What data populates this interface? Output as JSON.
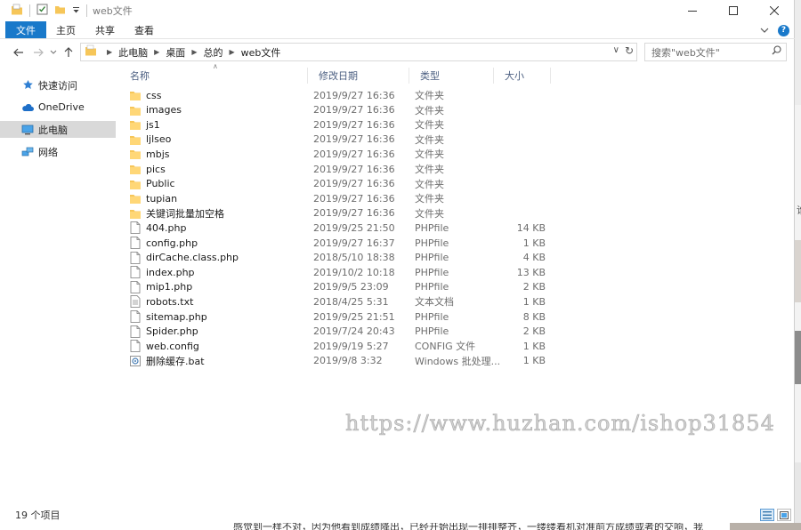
{
  "window": {
    "title": "web文件"
  },
  "ribbon": {
    "tabs": [
      "文件",
      "主页",
      "共享",
      "查看"
    ]
  },
  "address": {
    "crumbs": [
      "此电脑",
      "桌面",
      "总的",
      "web文件"
    ]
  },
  "search": {
    "placeholder": "搜索\"web文件\""
  },
  "sidebar": {
    "items": [
      {
        "label": "快速访问"
      },
      {
        "label": "OneDrive"
      },
      {
        "label": "此电脑"
      },
      {
        "label": "网络"
      }
    ]
  },
  "columns": {
    "name": "名称",
    "date": "修改日期",
    "type": "类型",
    "size": "大小"
  },
  "files": [
    {
      "name": "css",
      "date": "2019/9/27 16:36",
      "type": "文件夹",
      "size": "",
      "kind": "folder"
    },
    {
      "name": "images",
      "date": "2019/9/27 16:36",
      "type": "文件夹",
      "size": "",
      "kind": "folder"
    },
    {
      "name": "js1",
      "date": "2019/9/27 16:36",
      "type": "文件夹",
      "size": "",
      "kind": "folder"
    },
    {
      "name": "ljlseo",
      "date": "2019/9/27 16:36",
      "type": "文件夹",
      "size": "",
      "kind": "folder"
    },
    {
      "name": "mbjs",
      "date": "2019/9/27 16:36",
      "type": "文件夹",
      "size": "",
      "kind": "folder"
    },
    {
      "name": "pics",
      "date": "2019/9/27 16:36",
      "type": "文件夹",
      "size": "",
      "kind": "folder"
    },
    {
      "name": "Public",
      "date": "2019/9/27 16:36",
      "type": "文件夹",
      "size": "",
      "kind": "folder"
    },
    {
      "name": "tupian",
      "date": "2019/9/27 16:36",
      "type": "文件夹",
      "size": "",
      "kind": "folder"
    },
    {
      "name": "关键词批量加空格",
      "date": "2019/9/27 16:36",
      "type": "文件夹",
      "size": "",
      "kind": "folder"
    },
    {
      "name": "404.php",
      "date": "2019/9/25 21:50",
      "type": "PHPfile",
      "size": "14 KB",
      "kind": "file"
    },
    {
      "name": "config.php",
      "date": "2019/9/27 16:37",
      "type": "PHPfile",
      "size": "1 KB",
      "kind": "file"
    },
    {
      "name": "dirCache.class.php",
      "date": "2018/5/10 18:38",
      "type": "PHPfile",
      "size": "4 KB",
      "kind": "file"
    },
    {
      "name": "index.php",
      "date": "2019/10/2 10:18",
      "type": "PHPfile",
      "size": "13 KB",
      "kind": "file"
    },
    {
      "name": "mip1.php",
      "date": "2019/9/5 23:09",
      "type": "PHPfile",
      "size": "2 KB",
      "kind": "file"
    },
    {
      "name": "robots.txt",
      "date": "2018/4/25 5:31",
      "type": "文本文档",
      "size": "1 KB",
      "kind": "text"
    },
    {
      "name": "sitemap.php",
      "date": "2019/9/25 21:51",
      "type": "PHPfile",
      "size": "8 KB",
      "kind": "file"
    },
    {
      "name": "Spider.php",
      "date": "2019/7/24 20:43",
      "type": "PHPfile",
      "size": "2 KB",
      "kind": "file"
    },
    {
      "name": "web.config",
      "date": "2019/9/19 5:27",
      "type": "CONFIG 文件",
      "size": "1 KB",
      "kind": "file"
    },
    {
      "name": "删除缓存.bat",
      "date": "2019/9/8 3:32",
      "type": "Windows 批处理...",
      "size": "1 KB",
      "kind": "bat"
    }
  ],
  "status": {
    "count": "19 个项目"
  },
  "watermark": "https://www.huzhan.com/ishop31854",
  "backdrop": {
    "right_char": "谁",
    "bottom_text": "感觉到一样不对，因为他看到成绩降出，已经开始出现一排排整齐，一缕缕着机对准前方成绩或者的交响，我"
  },
  "colors": {
    "accent": "#1979ca",
    "folder": "#f6c659",
    "selected": "#d9d9d9"
  }
}
